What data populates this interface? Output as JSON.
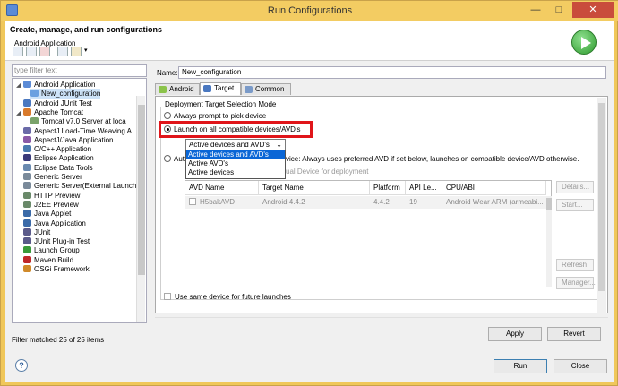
{
  "window": {
    "title": "Run Configurations"
  },
  "header": {
    "title": "Create, manage, and run configurations",
    "subtitle": "Android Application"
  },
  "filter": {
    "placeholder": "type filter text",
    "status": "Filter matched 25 of 25 items"
  },
  "tree": [
    {
      "label": "Android Application",
      "icon": "android-app-icon",
      "color": "#5b8bd6",
      "expanded": true,
      "indent": 1
    },
    {
      "label": "New_configuration",
      "icon": "android-config-icon",
      "color": "#6aa0e0",
      "indent": 2,
      "selected": true
    },
    {
      "label": "Android JUnit Test",
      "icon": "junit-icon",
      "color": "#4a78c0",
      "indent": 1
    },
    {
      "label": "Apache Tomcat",
      "icon": "tomcat-icon",
      "color": "#d97a2b",
      "expanded": true,
      "indent": 1
    },
    {
      "label": "Tomcat v7.0 Server at loca",
      "icon": "server-icon",
      "color": "#7aa36a",
      "indent": 2
    },
    {
      "label": "AspectJ Load-Time Weaving A",
      "icon": "aspectj-icon",
      "color": "#6a6aa8",
      "indent": 1
    },
    {
      "label": "AspectJ/Java Application",
      "icon": "aspectj-java-icon",
      "color": "#8a5aa8",
      "indent": 1
    },
    {
      "label": "C/C++ Application",
      "icon": "cpp-icon",
      "color": "#4a7ab0",
      "indent": 1
    },
    {
      "label": "Eclipse Application",
      "icon": "eclipse-icon",
      "color": "#3a3a7a",
      "indent": 1
    },
    {
      "label": "Eclipse Data Tools",
      "icon": "data-tools-icon",
      "color": "#6a8ab0",
      "indent": 1
    },
    {
      "label": "Generic Server",
      "icon": "generic-server-icon",
      "color": "#7a8a9a",
      "indent": 1
    },
    {
      "label": "Generic Server(External Launch",
      "icon": "generic-server-ext-icon",
      "color": "#7a8a9a",
      "indent": 1
    },
    {
      "label": "HTTP Preview",
      "icon": "http-preview-icon",
      "color": "#6a8a6a",
      "indent": 1
    },
    {
      "label": "J2EE Preview",
      "icon": "j2ee-icon",
      "color": "#6a8a6a",
      "indent": 1
    },
    {
      "label": "Java Applet",
      "icon": "java-applet-icon",
      "color": "#3a6aa8",
      "indent": 1
    },
    {
      "label": "Java Application",
      "icon": "java-app-icon",
      "color": "#3a6aa8",
      "indent": 1
    },
    {
      "label": "JUnit",
      "icon": "junit-icon",
      "color": "#5a5a8a",
      "indent": 1
    },
    {
      "label": "JUnit Plug-in Test",
      "icon": "junit-plugin-icon",
      "color": "#5a5a8a",
      "indent": 1
    },
    {
      "label": "Launch Group",
      "icon": "launch-group-icon",
      "color": "#3a9a3a",
      "indent": 1
    },
    {
      "label": "Maven Build",
      "icon": "maven-icon",
      "color": "#c0282a",
      "indent": 1
    },
    {
      "label": "OSGi Framework",
      "icon": "osgi-icon",
      "color": "#d08a2a",
      "indent": 1
    }
  ],
  "name": {
    "label": "Name:",
    "value": "New_configuration"
  },
  "tabs": [
    {
      "label": "Android",
      "icon": "android-tab-icon",
      "color": "#8bc34a"
    },
    {
      "label": "Target",
      "icon": "target-tab-icon",
      "color": "#4a78c0",
      "active": true
    },
    {
      "label": "Common",
      "icon": "common-tab-icon",
      "color": "#7a9ac8"
    }
  ],
  "target": {
    "group_title": "Deployment Target Selection Mode",
    "radio_prompt": "Always prompt to pick device",
    "radio_launch_all": "Launch on all compatible devices/AVD's",
    "select_value": "Active devices and AVD's",
    "options": [
      "Active devices and AVD's",
      "Active AVD's",
      "Active devices"
    ],
    "radio_auto_prefix": "Aut",
    "radio_auto_rest": "vice: Always uses preferred AVD if set below, launches on compatible device/AVD otherwise.",
    "grey_note": "ual Device for deployment",
    "columns": [
      "AVD Name",
      "Target Name",
      "Platform",
      "API Le...",
      "CPU/ABI"
    ],
    "rows": [
      {
        "avd": "H5bakAVD",
        "target": "Android 4.4.2",
        "platform": "4.4.2",
        "api": "19",
        "cpu": "Android Wear ARM (armeabi..."
      }
    ],
    "side_buttons": [
      "Details...",
      "Start...",
      "Refresh",
      "Manager..."
    ],
    "same_device": "Use same device for future launches"
  },
  "buttons": {
    "apply": "Apply",
    "revert": "Revert",
    "run": "Run",
    "close": "Close"
  },
  "help_glyph": "?",
  "colors": {
    "highlight": "#e0151a",
    "selection": "#0a66d6"
  }
}
